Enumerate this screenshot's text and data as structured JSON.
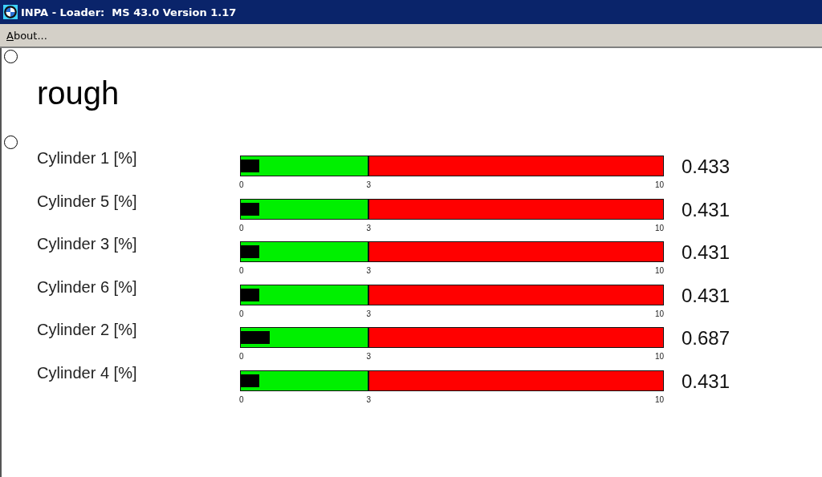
{
  "window": {
    "title": "INPA - Loader:  MS 43.0 Version 1.17"
  },
  "menu": [
    {
      "label": "About..."
    }
  ],
  "heading": "rough",
  "rows": [
    {
      "label": "Cylinder 1 [%]",
      "level": 0.0433,
      "reading": "0.433",
      "ticks": [
        "0",
        "3",
        "10"
      ]
    },
    {
      "label": "Cylinder 5 [%]",
      "level": 0.0431,
      "reading": "0.431",
      "ticks": [
        "0",
        "3",
        "10"
      ]
    },
    {
      "label": "Cylinder 3 [%]",
      "level": 0.0431,
      "reading": "0.431",
      "ticks": [
        "0",
        "3",
        "10"
      ]
    },
    {
      "label": "Cylinder 6 [%]",
      "level": 0.0431,
      "reading": "0.431",
      "ticks": [
        "0",
        "3",
        "10"
      ]
    },
    {
      "label": "Cylinder 2 [%]",
      "level": 0.0687,
      "reading": "0.687",
      "ticks": [
        "0",
        "3",
        "10"
      ]
    },
    {
      "label": "Cylinder 4 [%]",
      "level": 0.0431,
      "reading": "0.431",
      "ticks": [
        "0",
        "3",
        "10"
      ]
    }
  ]
}
